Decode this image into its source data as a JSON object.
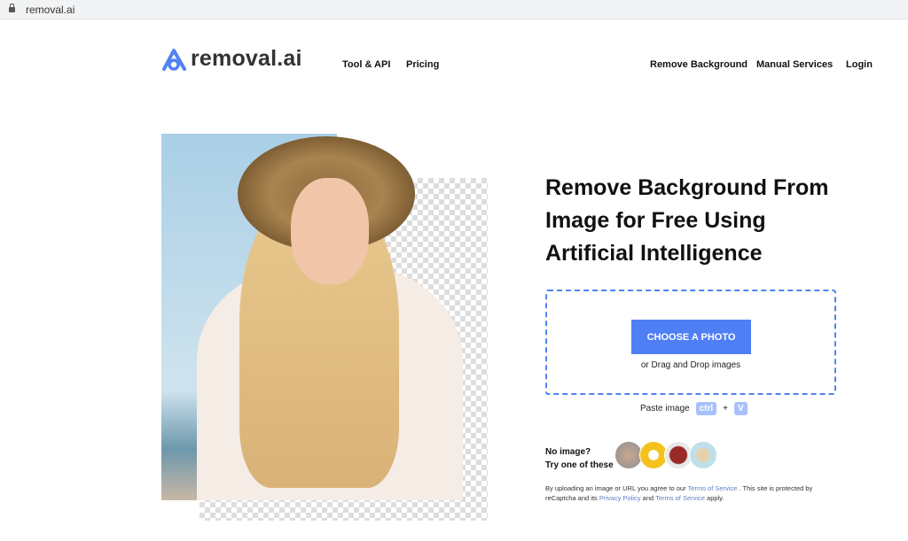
{
  "browser": {
    "url": "removal.ai"
  },
  "header": {
    "logo_text": "removal.ai",
    "nav_left": [
      "Tool & API",
      "Pricing"
    ],
    "nav_right": [
      "Remove Background",
      "Manual Services",
      "Login"
    ]
  },
  "hero": {
    "title": "Remove Background From Image for Free Using Artificial Intelligence"
  },
  "upload": {
    "button": "CHOOSE A PHOTO",
    "drag_text": "or Drag and Drop images",
    "paste_label": "Paste image",
    "key1": "ctrl",
    "plus": "+",
    "key2": "V"
  },
  "samples": {
    "line1": "No image?",
    "line2": "Try one of these"
  },
  "legal": {
    "t1": "By uploading an image or URL you agree to our ",
    "link1": "Terms of Service",
    "t2": " . This site is protected by reCaptcha and its ",
    "link2": "Privacy Policy",
    "t3": " and ",
    "link3": "Terms of Service",
    "t4": " apply."
  },
  "colors": {
    "accent": "#4f7ff4",
    "key_bg": "#a8c1fb"
  }
}
